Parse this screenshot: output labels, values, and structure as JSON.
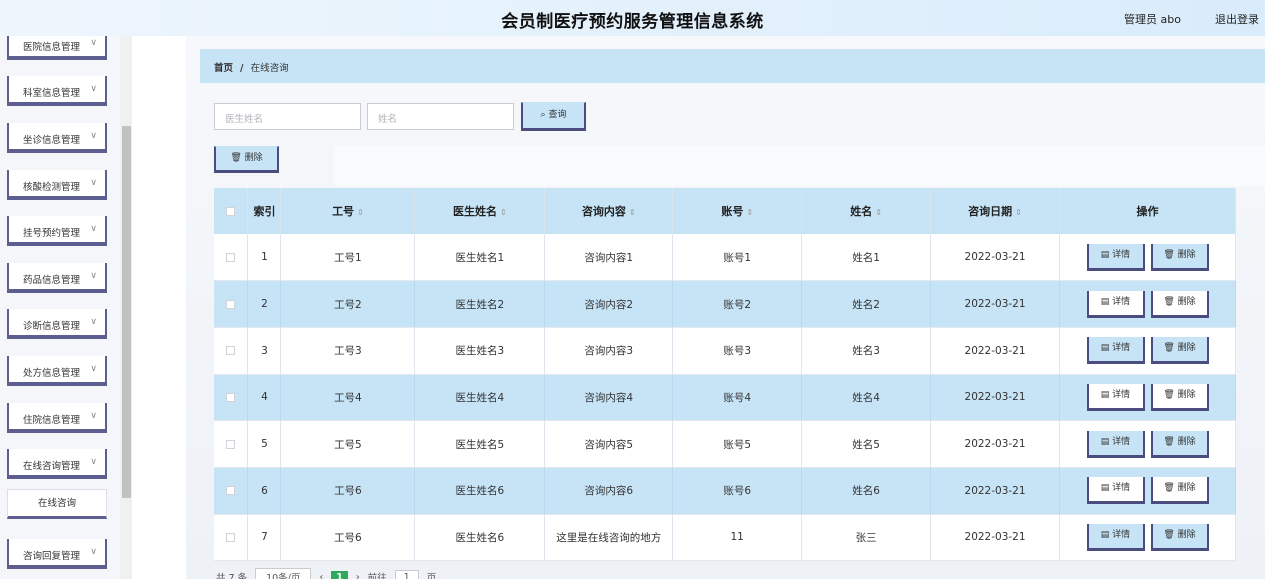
{
  "header": {
    "title": "会员制医疗预约服务管理信息系统",
    "user": "管理员 abo",
    "logout": "退出登录"
  },
  "sidebar": {
    "items": [
      {
        "label": "医院信息管理"
      },
      {
        "label": "科室信息管理"
      },
      {
        "label": "坐诊信息管理"
      },
      {
        "label": "核酸检测管理"
      },
      {
        "label": "挂号预约管理"
      },
      {
        "label": "药品信息管理"
      },
      {
        "label": "诊断信息管理"
      },
      {
        "label": "处方信息管理"
      },
      {
        "label": "住院信息管理"
      },
      {
        "label": "在线咨询管理"
      }
    ],
    "sub_item": "在线咨询",
    "last_item": "咨询回复管理",
    "chevron": "∨"
  },
  "breadcrumb": {
    "home": "首页",
    "sep": "/",
    "current": "在线咨询"
  },
  "search": {
    "doctor_placeholder": "医生姓名",
    "name_placeholder": "姓名",
    "button": "查询",
    "search_icon": "magnifier-icon"
  },
  "toolbar": {
    "delete": "删除",
    "delete_icon": "trash-icon"
  },
  "table": {
    "headers": [
      "索引",
      "工号",
      "医生姓名",
      "咨询内容",
      "账号",
      "姓名",
      "咨询日期",
      "操作"
    ],
    "rows": [
      {
        "index": "1",
        "job": "工号1",
        "doctor": "医生姓名1",
        "content": "咨询内容1",
        "account": "账号1",
        "name": "姓名1",
        "date": "2022-03-21"
      },
      {
        "index": "2",
        "job": "工号2",
        "doctor": "医生姓名2",
        "content": "咨询内容2",
        "account": "账号2",
        "name": "姓名2",
        "date": "2022-03-21"
      },
      {
        "index": "3",
        "job": "工号3",
        "doctor": "医生姓名3",
        "content": "咨询内容3",
        "account": "账号3",
        "name": "姓名3",
        "date": "2022-03-21"
      },
      {
        "index": "4",
        "job": "工号4",
        "doctor": "医生姓名4",
        "content": "咨询内容4",
        "account": "账号4",
        "name": "姓名4",
        "date": "2022-03-21"
      },
      {
        "index": "5",
        "job": "工号5",
        "doctor": "医生姓名5",
        "content": "咨询内容5",
        "account": "账号5",
        "name": "姓名5",
        "date": "2022-03-21"
      },
      {
        "index": "6",
        "job": "工号6",
        "doctor": "医生姓名6",
        "content": "咨询内容6",
        "account": "账号6",
        "name": "姓名6",
        "date": "2022-03-21"
      },
      {
        "index": "7",
        "job": "工号6",
        "doctor": "医生姓名6",
        "content": "这里是在线咨询的地方",
        "account": "11",
        "name": "张三",
        "date": "2022-03-21"
      }
    ],
    "detail_label": "详情",
    "delete_label": "删除"
  },
  "pager": {
    "total": "共 7 条",
    "size": "10条/页",
    "page": "1",
    "goto": "前往",
    "goto_page": "1",
    "unit": "页"
  },
  "colors": {
    "accent": "#c7e4f7",
    "border": "#4a4d7e",
    "page_active": "#2fa95c"
  }
}
